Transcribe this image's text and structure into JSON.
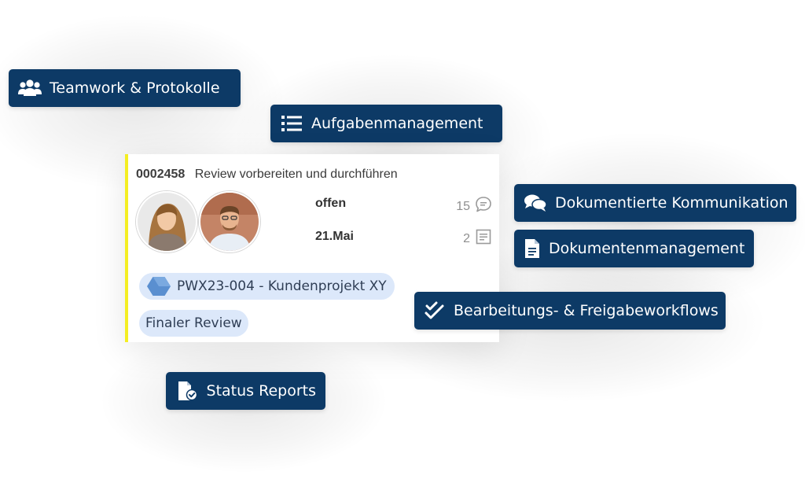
{
  "features": {
    "teamwork": "Teamwork & Protokolle",
    "tasks": "Aufgabenmanagement",
    "communication": "Dokumentierte Kommunikation",
    "documents": "Dokumentenmanagement",
    "workflows": "Bearbeitungs- & Freigabeworkflows",
    "reports": "Status Reports"
  },
  "task": {
    "id": "0002458",
    "title": "Review vorbereiten und durchführen",
    "status": "offen",
    "due": "21.Mai",
    "comments_count": "15",
    "documents_count": "2",
    "project": "PWX23-004 - Kundenprojekt XY",
    "phase": "Finaler Review"
  },
  "icons": {
    "teamwork": "users-icon",
    "tasks": "list-icon",
    "communication": "chat-bubbles-icon",
    "documents": "document-icon",
    "workflows": "double-check-icon",
    "reports": "report-check-icon",
    "comments": "comment-icon",
    "attachments": "notes-icon",
    "project": "hexagon-icon"
  },
  "colors": {
    "pill_bg": "#0d3a66",
    "card_accent": "#f4ee23",
    "chip_bg": "#dce8fa",
    "project_icon": "#5a8fd0"
  }
}
